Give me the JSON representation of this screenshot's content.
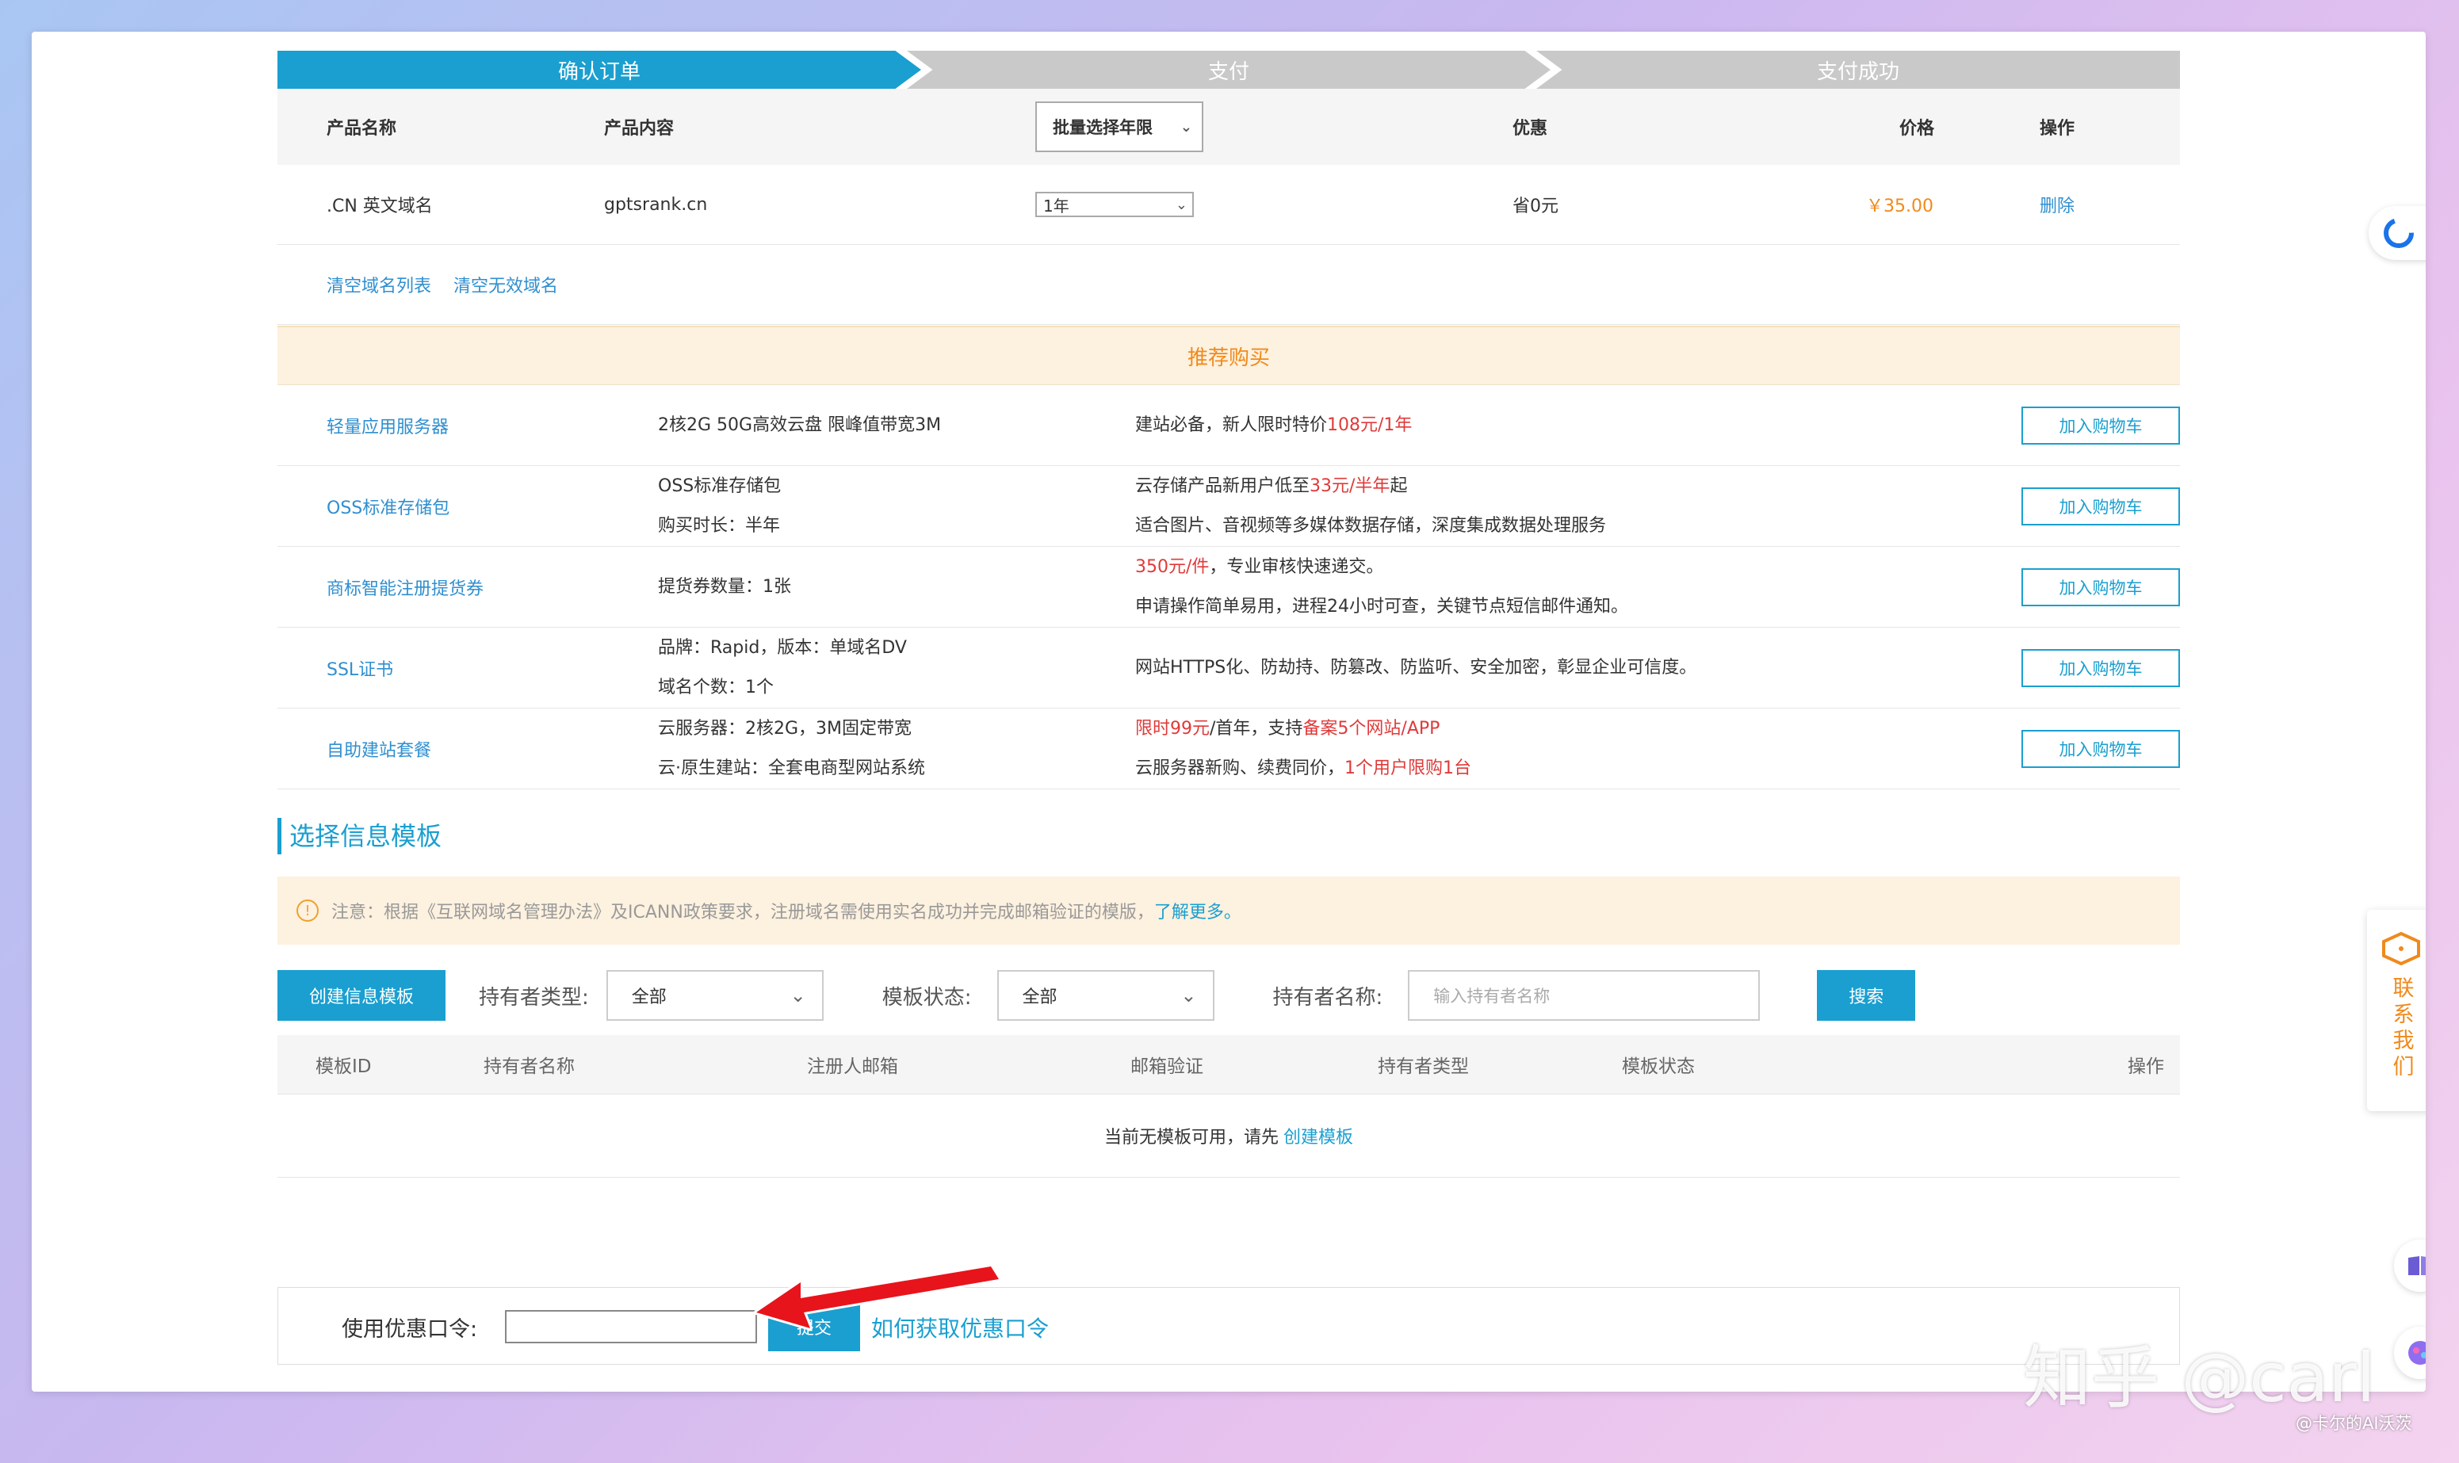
{
  "steps": [
    "确认订单",
    "支付",
    "支付成功"
  ],
  "order_table": {
    "headers": {
      "name": "产品名称",
      "content": "产品内容",
      "years_select": "批量选择年限",
      "discount": "优惠",
      "price": "价格",
      "action": "操作"
    },
    "rows": [
      {
        "name": ".CN 英文域名",
        "content": "gptsrank.cn",
        "years": "1年",
        "discount": "省0元",
        "price": "￥35.00",
        "action": "删除"
      }
    ]
  },
  "links": {
    "clear_list": "清空域名列表",
    "clear_invalid": "清空无效域名"
  },
  "recommend": {
    "title": "推荐购买",
    "cart_label": "加入购物车",
    "items": [
      {
        "name": "轻量应用服务器",
        "content": [
          "2核2G 50G高效云盘 限峰值带宽3M"
        ],
        "desc1_pre": "建站必备，新人限时特价",
        "desc1_red": "108元/1年",
        "desc1_post": "",
        "desc2": ""
      },
      {
        "name": "OSS标准存储包",
        "content": [
          "OSS标准存储包",
          "购买时长：半年"
        ],
        "desc1_pre": "云存储产品新用户低至",
        "desc1_red": "33元/半年",
        "desc1_post": "起",
        "desc2": "适合图片、音视频等多媒体数据存储，深度集成数据处理服务"
      },
      {
        "name": "商标智能注册提货券",
        "content": [
          "提货券数量：1张"
        ],
        "desc1_pre": "",
        "desc1_red": "350元/件",
        "desc1_post": "，专业审核快速递交。",
        "desc2": "申请操作简单易用，进程24小时可查，关键节点短信邮件通知。"
      },
      {
        "name": "SSL证书",
        "content": [
          "品牌：Rapid，版本：单域名DV",
          "域名个数：1个"
        ],
        "desc1_pre": "网站HTTPS化、防劫持、防篡改、防监听、安全加密，彰显企业可信度。",
        "desc1_red": "",
        "desc1_post": "",
        "desc2": ""
      },
      {
        "name": "自助建站套餐",
        "content": [
          "云服务器：2核2G，3M固定带宽",
          "云·原生建站：全套电商型网站系统"
        ],
        "desc1_pre": "",
        "desc1_red": "限时99元",
        "desc1_post": "/首年，支持",
        "desc1_red2": "备案5个网站/APP",
        "desc2_pre": "云服务器新购、续费同价，",
        "desc2_red": "1个用户限购1台"
      }
    ]
  },
  "template_section": {
    "title": "选择信息模板",
    "notice": "注意：根据《互联网域名管理办法》及ICANN政策要求，注册域名需使用实名成功并完成邮箱验证的模版，",
    "notice_link": "了解更多。",
    "create_btn": "创建信息模板",
    "holder_type_label": "持有者类型:",
    "holder_type_value": "全部",
    "status_label": "模板状态:",
    "status_value": "全部",
    "holder_name_label": "持有者名称:",
    "holder_name_placeholder": "输入持有者名称",
    "search_btn": "搜索",
    "columns": [
      "模板ID",
      "持有者名称",
      "注册人邮箱",
      "邮箱验证",
      "持有者类型",
      "模板状态",
      "操作"
    ],
    "empty_text": "当前无模板可用，请先",
    "empty_link": "创建模板"
  },
  "coupon": {
    "label": "使用优惠口令:",
    "value": "",
    "submit": "提交",
    "how_link": "如何获取优惠口令"
  },
  "contact": {
    "label": "联系我们"
  },
  "watermark": {
    "main": "知乎 @carl",
    "sub": "@卡尔的AI沃茨"
  },
  "colors": {
    "primary": "#1a9fd0",
    "accent_orange": "#f08a1c",
    "red": "#e03a3a",
    "annotation_arrow": "#e8141b"
  }
}
